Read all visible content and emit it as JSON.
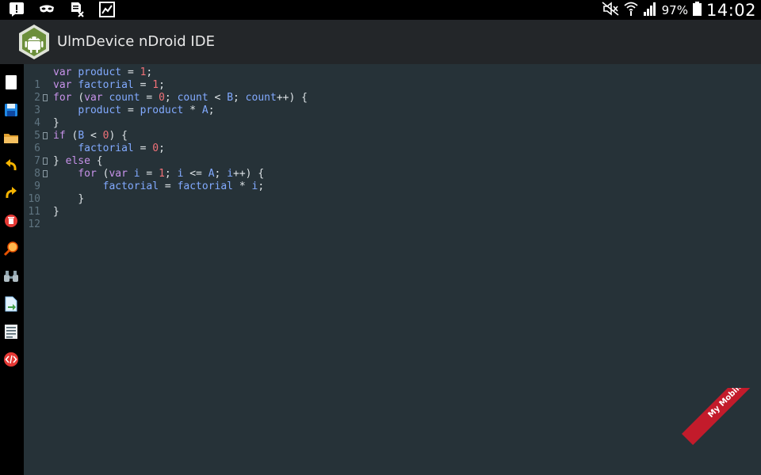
{
  "status_bar": {
    "battery_percent": "97%",
    "time": "14:02",
    "icons": [
      "alert-icon",
      "incognito-mask-icon",
      "document-x-icon",
      "gallery-icon",
      "mute-icon",
      "wifi-icon",
      "signal-icon",
      "battery-icon"
    ]
  },
  "app": {
    "title": "UlmDevice nDroid IDE",
    "logo_icon": "android-logo-icon"
  },
  "toolbar": {
    "buttons": [
      "new-file",
      "save",
      "open-folder",
      "undo",
      "redo",
      "delete",
      "search",
      "binoculars",
      "export-file",
      "text-document",
      "code"
    ]
  },
  "editor": {
    "background": "#263238",
    "colors": {
      "keyword": "#c792ea",
      "identifier": "#82aaff",
      "number": "#f07178",
      "plain": "#dde3e6",
      "line_number": "#5f7480"
    },
    "lines": [
      {
        "num": "1",
        "code": "var product = 1;"
      },
      {
        "num": "2",
        "code": "var factorial = 1;"
      },
      {
        "num": "3",
        "code": "for (var count = 0; count < B; count++) {"
      },
      {
        "num": "4",
        "code": "    product = product * A;"
      },
      {
        "num": "5",
        "code": "}"
      },
      {
        "num": "6",
        "code": "if (B < 0) {"
      },
      {
        "num": "7",
        "code": "    factorial = 0;"
      },
      {
        "num": "8",
        "code": "} else {"
      },
      {
        "num": "9",
        "code": "    for (var i = 1; i <= A; i++) {"
      },
      {
        "num": "10",
        "code": "        factorial = factorial * i;"
      },
      {
        "num": "11",
        "code": "    }"
      },
      {
        "num": "12",
        "code": "}"
      }
    ]
  },
  "watermark": {
    "text": "My Mobile Apps"
  }
}
